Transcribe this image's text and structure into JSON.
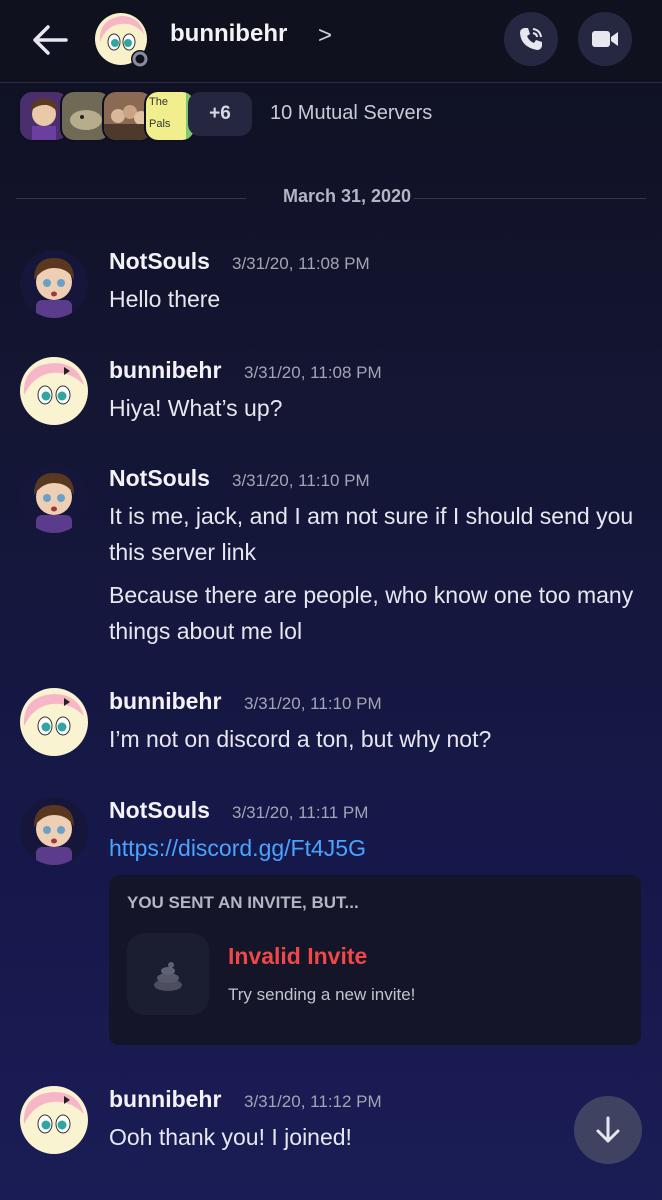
{
  "header": {
    "name": "bunnibehr",
    "chevron": ">"
  },
  "mutual": {
    "plus_count": "+6",
    "label": "10 Mutual Servers",
    "server_tag_line1": "The",
    "server_tag_line2": "Pals"
  },
  "date_divider": "March 31, 2020",
  "messages": [
    {
      "author": "NotSouls",
      "time": "3/31/20, 11:08 PM",
      "lines": [
        "Hello there"
      ]
    },
    {
      "author": "bunnibehr",
      "time": "3/31/20, 11:08 PM",
      "lines": [
        "Hiya! What’s up?"
      ]
    },
    {
      "author": "NotSouls",
      "time": "3/31/20, 11:10 PM",
      "lines": [
        "It is me, jack, and I am not sure if I should send you this server link",
        "Because there are people, who know one too many things about me lol"
      ]
    },
    {
      "author": "bunnibehr",
      "time": "3/31/20, 11:10 PM",
      "lines": [
        "I’m not on discord a ton, but why not?"
      ]
    },
    {
      "author": "NotSouls",
      "time": "3/31/20, 11:11 PM",
      "lines": [
        "https://discord.gg/Ft4J5G"
      ]
    },
    {
      "author": "bunnibehr",
      "time": "3/31/20, 11:12 PM",
      "lines": [
        "Ooh thank you! I joined!"
      ]
    }
  ],
  "invite": {
    "heading": "YOU SENT AN INVITE, BUT...",
    "title": "Invalid Invite",
    "subtitle": "Try sending a new invite!"
  },
  "colors": {
    "link": "#4aa3ff",
    "error": "#f04747"
  }
}
